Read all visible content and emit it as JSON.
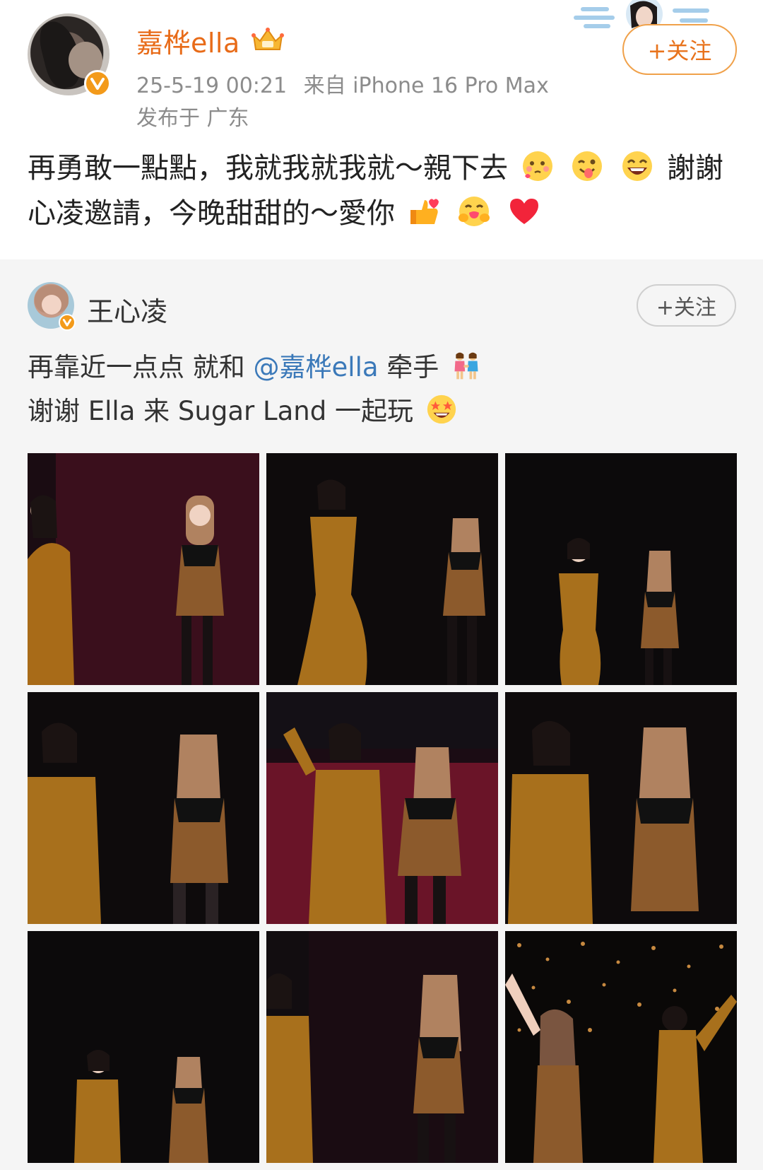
{
  "post": {
    "author": "嘉桦ella",
    "timestamp": "25-5-19 00:21",
    "source": "来自 iPhone 16 Pro Max",
    "location": "发布于 广东",
    "follow_label": "+关注",
    "text_part1": "再勇敢一點點，我就我就我就～親下去",
    "text_part2": " 謝謝心凌邀請，今晚甜甜的～愛你"
  },
  "repost": {
    "author": "王心凌",
    "follow_label": "+关注",
    "text_line1_prefix": "再靠近一点点 就和 ",
    "mention": "@嘉桦ella",
    "text_line1_suffix": " 牵手",
    "text_line2": "谢谢 Ella 来 Sugar Land 一起玩"
  },
  "colors": {
    "author_name": "#e86b18",
    "verified_badge": "#f39a1a",
    "mention": "#3b79b9",
    "card_background": "#f5f5f5"
  },
  "icons": [
    "crown-icon",
    "verified-badge-icon",
    "woozy-kiss-emoji",
    "tongue-wink-emoji",
    "laughing-emoji",
    "heart-thumbs-up-emoji",
    "hugging-face-emoji",
    "red-heart-emoji",
    "two-women-holding-hands-emoji",
    "star-struck-emoji"
  ],
  "photos": [
    "photo-1",
    "photo-2",
    "photo-3",
    "photo-4",
    "photo-5",
    "photo-6",
    "photo-7",
    "photo-8",
    "photo-9"
  ]
}
